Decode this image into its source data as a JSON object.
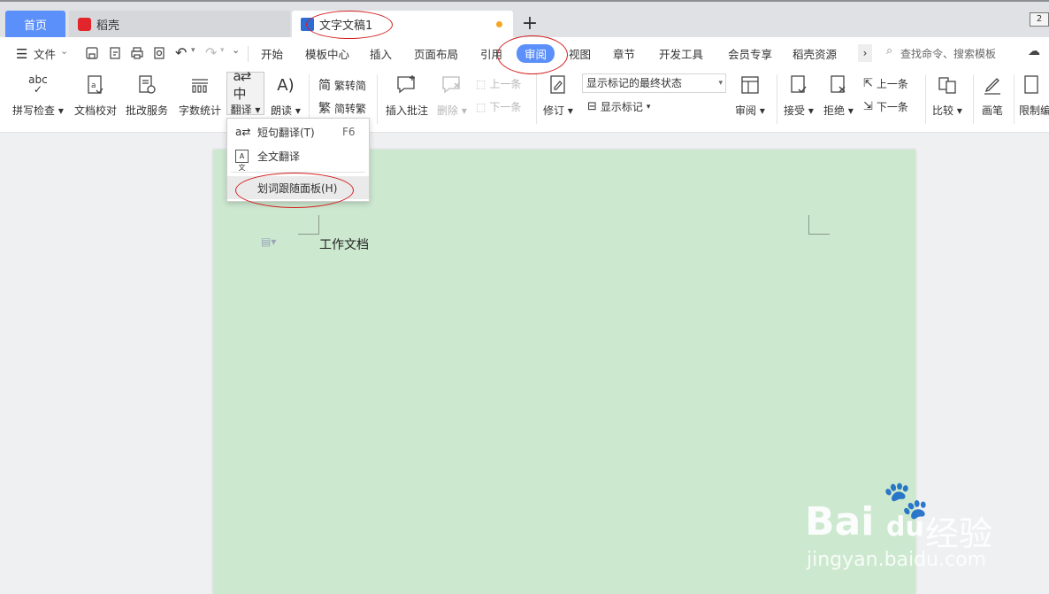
{
  "tabs": {
    "home": "首页",
    "daoke": "稻壳",
    "doc": "文字文稿1",
    "add": "+",
    "win": "2"
  },
  "menu": [
    "文件",
    "开始",
    "模板中心",
    "插入",
    "页面布局",
    "引用",
    "审阅",
    "视图",
    "章节",
    "开发工具",
    "会员专享",
    "稻壳资源"
  ],
  "search_placeholder": "查找命令、搜索模板",
  "ribbon": {
    "spell": "拼写检查",
    "proof": "文档校对",
    "batch": "批改服务",
    "count": "字数统计",
    "translate": "翻译",
    "read": "朗读",
    "t2s": "繁转简",
    "s2t": "简转繁",
    "insert_comment": "插入批注",
    "delete": "删除",
    "prev": "上一条",
    "next": "下一条",
    "revise": "修订",
    "markup_state": "显示标记的最终状态",
    "show_markup": "显示标记",
    "review": "审阅",
    "accept": "接受",
    "reject": "拒绝",
    "prev2": "上一条",
    "next2": "下一条",
    "compare": "比较",
    "pen": "画笔",
    "restrict": "限制编"
  },
  "dropdown": {
    "item1": "短句翻译(T)",
    "item1_key": "F6",
    "item2": "全文翻译",
    "item3": "划词跟随面板(H)"
  },
  "doc_text": "工作文档",
  "watermark": {
    "brand": "Bai",
    "brand2": "du",
    "cn": "经验",
    "url": "jingyan.baidu.com"
  },
  "colors": {
    "accent": "#5b8ff9",
    "page": "#cce8cf",
    "annotation": "#d21f1f"
  }
}
